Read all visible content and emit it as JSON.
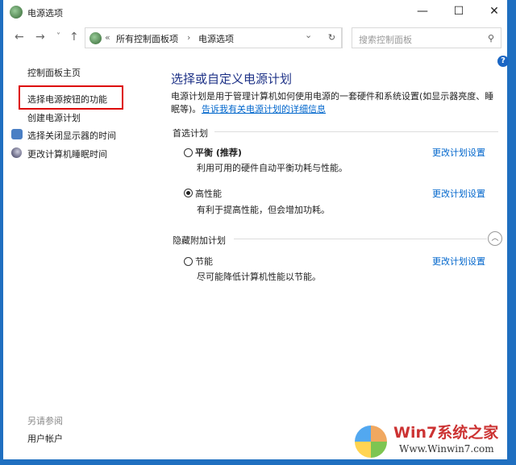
{
  "window": {
    "title": "电源选项",
    "min": "—",
    "max": "☐",
    "close": "✕"
  },
  "nav": {
    "back": "←",
    "forward": "→",
    "recent": "˅",
    "up": "↑",
    "chevrons": "«",
    "crumbs": [
      "所有控制面板项",
      "电源选项"
    ],
    "sep": "›",
    "dropdown": "⌄",
    "refresh": "↻",
    "search_placeholder": "搜索控制面板",
    "search_icon": "⚲"
  },
  "sidebar": {
    "items": [
      "控制面板主页",
      "选择电源按钮的功能",
      "创建电源计划",
      "选择关闭显示器的时间",
      "更改计算机睡眠时间"
    ],
    "see_also": "另请参阅",
    "user_accounts": "用户帐户"
  },
  "main": {
    "title": "选择或自定义电源计划",
    "desc1": "电源计划是用于管理计算机如何使用电源的一套硬件和系统设置(如显示器亮度、睡",
    "desc2": "眠等)。",
    "more_link": "告诉我有关电源计划的详细信息",
    "preferred": "首选计划",
    "hidden": "隐藏附加计划",
    "plans": [
      {
        "name": "平衡 (推荐)",
        "desc": "利用可用的硬件自动平衡功耗与性能。",
        "selected": false,
        "change": "更改计划设置"
      },
      {
        "name": "高性能",
        "desc": "有利于提高性能，但会增加功耗。",
        "selected": true,
        "change": "更改计划设置"
      },
      {
        "name": "节能",
        "desc": "尽可能降低计算机性能以节能。",
        "selected": false,
        "change": "更改计划设置"
      }
    ],
    "help": "?"
  },
  "watermark": {
    "brand": "Win7系统之家",
    "url": "Www.Winwin7.com"
  }
}
